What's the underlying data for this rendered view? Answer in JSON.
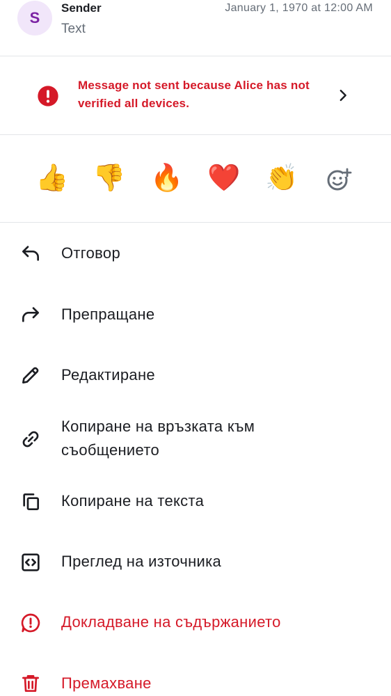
{
  "header": {
    "avatar_letter": "S",
    "sender": "Sender",
    "text": "Text",
    "timestamp": "January 1, 1970 at 12:00 AM"
  },
  "warning": {
    "message": "Message not sent because Alice has not verified all devices.",
    "icon": "error-icon",
    "action_icon": "chevron-right-icon"
  },
  "reactions": [
    "👍",
    "👎",
    "🔥",
    "❤️",
    "👏"
  ],
  "reaction_more_icon": "add-reaction-icon",
  "menu": [
    {
      "label": "Отговор",
      "icon": "reply-icon"
    },
    {
      "label": "Препращане",
      "icon": "forward-icon"
    },
    {
      "label": "Редактиране",
      "icon": "edit-icon"
    },
    {
      "label": "Копиране на връзката към съобщението",
      "icon": "link-icon"
    },
    {
      "label": "Копиране на текста",
      "icon": "copy-icon"
    },
    {
      "label": "Преглед на източника",
      "icon": "view-source-icon"
    },
    {
      "label": "Докладване на съдържанието",
      "icon": "report-icon"
    },
    {
      "label": "Премахване",
      "icon": "delete-icon"
    }
  ],
  "colors": {
    "text": "#1b1d22",
    "secondary": "#656d77",
    "critical": "#d51928",
    "avatar_bg": "#f1e6fa",
    "avatar_fg": "#7b22a3"
  }
}
